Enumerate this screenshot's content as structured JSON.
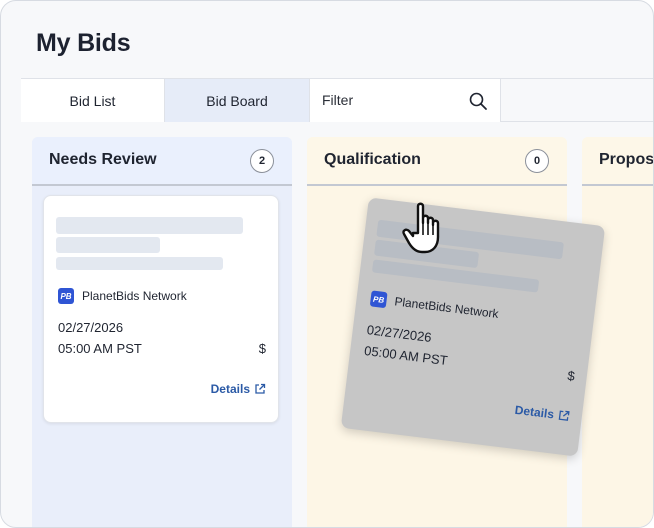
{
  "page": {
    "title": "My Bids"
  },
  "toolbar": {
    "tab_bid_list": "Bid List",
    "tab_bid_board": "Bid Board",
    "filter_placeholder": "Filter"
  },
  "columns": [
    {
      "title": "Needs Review",
      "count": "2"
    },
    {
      "title": "Qualification",
      "count": "0"
    },
    {
      "title": "Proposa"
    }
  ],
  "cards": [
    {
      "network": "PlanetBids Network",
      "logo": "PB",
      "date": "02/27/2026",
      "time": "05:00 AM PST",
      "amount": "$",
      "details": "Details"
    },
    {
      "network": "PlanetBids Network",
      "logo": "PB",
      "date": "02/27/2026",
      "time": "05:00 AM PST",
      "amount": "$",
      "details": "Details"
    }
  ],
  "icons": {
    "search": "search-icon",
    "external_link": "external-link-icon",
    "cursor": "hand-pointer-icon"
  },
  "colors": {
    "accent_link": "#2b5aa6",
    "logo_blue": "#2f55d4",
    "needs_review_bg": "#e9eefa",
    "qualification_bg": "#fdf6e6",
    "active_tab_bg": "#e6ecf8"
  }
}
